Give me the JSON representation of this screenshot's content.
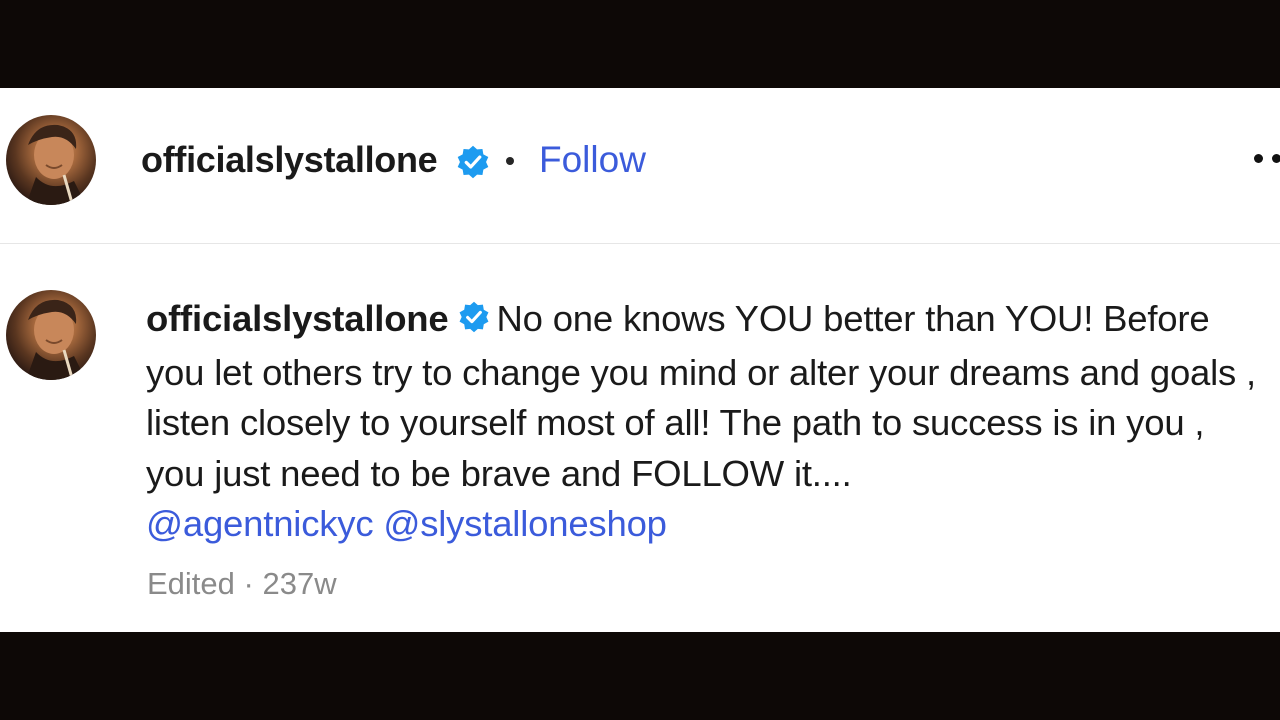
{
  "post": {
    "header": {
      "username": "officialslystallone",
      "follow_label": "Follow",
      "separator": "•"
    },
    "caption": {
      "username": "officialslystallone",
      "text": "No one knows YOU better than YOU! Before you let others try to change you mind or alter your dreams and goals , listen closely to yourself most of all! The path to success is in you , you just need to be brave and FOLLOW it....",
      "mentions": [
        "@agentnickyc",
        "@slystalloneshop"
      ]
    },
    "meta": {
      "edited_label": "Edited",
      "dot": "·",
      "age": "237w"
    },
    "icons": {
      "verified": "verified-badge-icon",
      "more": "more-options-icon"
    },
    "colors": {
      "verified_blue": "#1d9bf0",
      "link_blue": "#3b5bdb",
      "letterbox": "#0d0806"
    }
  }
}
